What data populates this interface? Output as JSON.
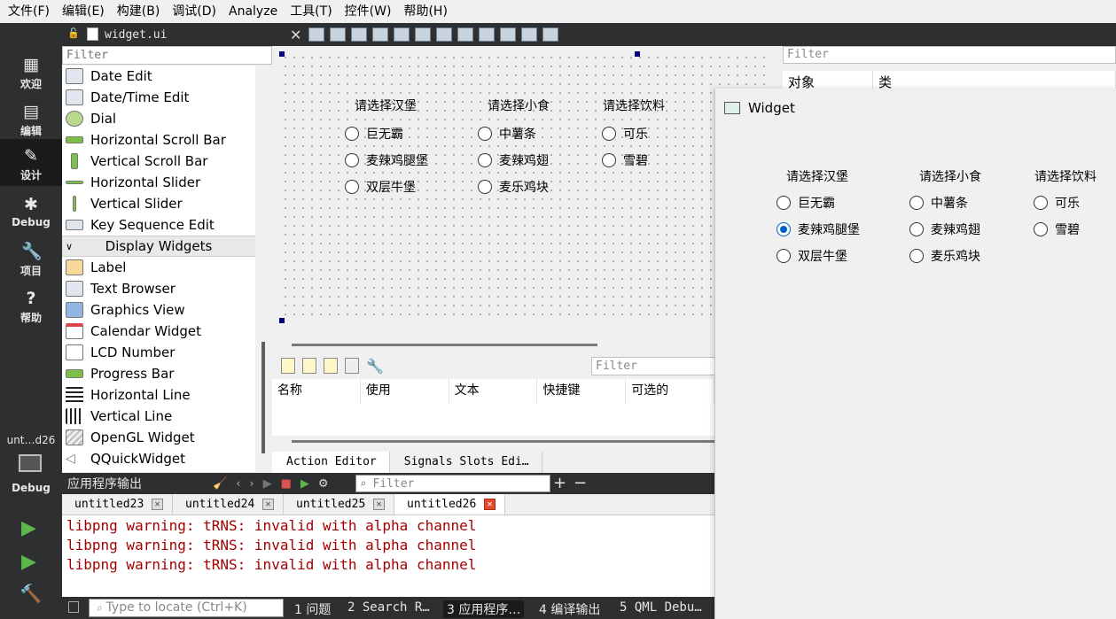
{
  "menubar": [
    "文件(F)",
    "编辑(E)",
    "构建(B)",
    "调试(D)",
    "Analyze",
    "工具(T)",
    "控件(W)",
    "帮助(H)"
  ],
  "modes": [
    {
      "label": "欢迎",
      "icon": "grid-icon"
    },
    {
      "label": "编辑",
      "icon": "document-icon"
    },
    {
      "label": "设计",
      "icon": "pencil-icon"
    },
    {
      "label": "Debug",
      "icon": "bug-icon"
    },
    {
      "label": "项目",
      "icon": "wrench-icon"
    },
    {
      "label": "帮助",
      "icon": "help-icon"
    }
  ],
  "kit": {
    "project": "unt…d26",
    "label": "Debug"
  },
  "editor": {
    "file_name": "widget.ui"
  },
  "widget_box": {
    "filter_placeholder": "Filter",
    "items_top": [
      "Date Edit",
      "Date/Time Edit",
      "Dial",
      "Horizontal Scroll Bar",
      "Vertical Scroll Bar",
      "Horizontal Slider",
      "Vertical Slider",
      "Key Sequence Edit"
    ],
    "category": "Display Widgets",
    "items_display": [
      "Label",
      "Text Browser",
      "Graphics View",
      "Calendar Widget",
      "LCD Number",
      "Progress Bar",
      "Horizontal Line",
      "Vertical Line",
      "OpenGL Widget",
      "QQuickWidget"
    ]
  },
  "form": {
    "groups": [
      {
        "title": "请选择汉堡",
        "options": [
          "巨无霸",
          "麦辣鸡腿堡",
          "双层牛堡"
        ]
      },
      {
        "title": "请选择小食",
        "options": [
          "中薯条",
          "麦辣鸡翅",
          "麦乐鸡块"
        ]
      },
      {
        "title": "请选择饮料",
        "options": [
          "可乐",
          "雪碧"
        ]
      }
    ]
  },
  "object_inspector": {
    "filter_placeholder": "Filter",
    "col_object": "对象",
    "col_class": "类"
  },
  "action_editor": {
    "filter_placeholder": "Filter",
    "columns": [
      "名称",
      "使用",
      "文本",
      "快捷键",
      "可选的"
    ],
    "tabs": [
      "Action Editor",
      "Signals  Slots Edi…"
    ]
  },
  "output": {
    "title": "应用程序输出",
    "filter_placeholder": "Filter",
    "tabs": [
      "untitled23",
      "untitled24",
      "untitled25",
      "untitled26"
    ],
    "lines": [
      "libpng warning: tRNS: invalid with alpha channel",
      "libpng warning: tRNS: invalid with alpha channel",
      "libpng warning: tRNS: invalid with alpha channel"
    ]
  },
  "statusbar": {
    "locate_placeholder": "Type to locate (Ctrl+K)",
    "items": [
      "1 问题",
      "2 Search R…",
      "3 应用程序…",
      "4 编译输出",
      "5 QML Debu…"
    ]
  },
  "runtime_window": {
    "title": "Widget",
    "selected": "麦辣鸡腿堡"
  }
}
